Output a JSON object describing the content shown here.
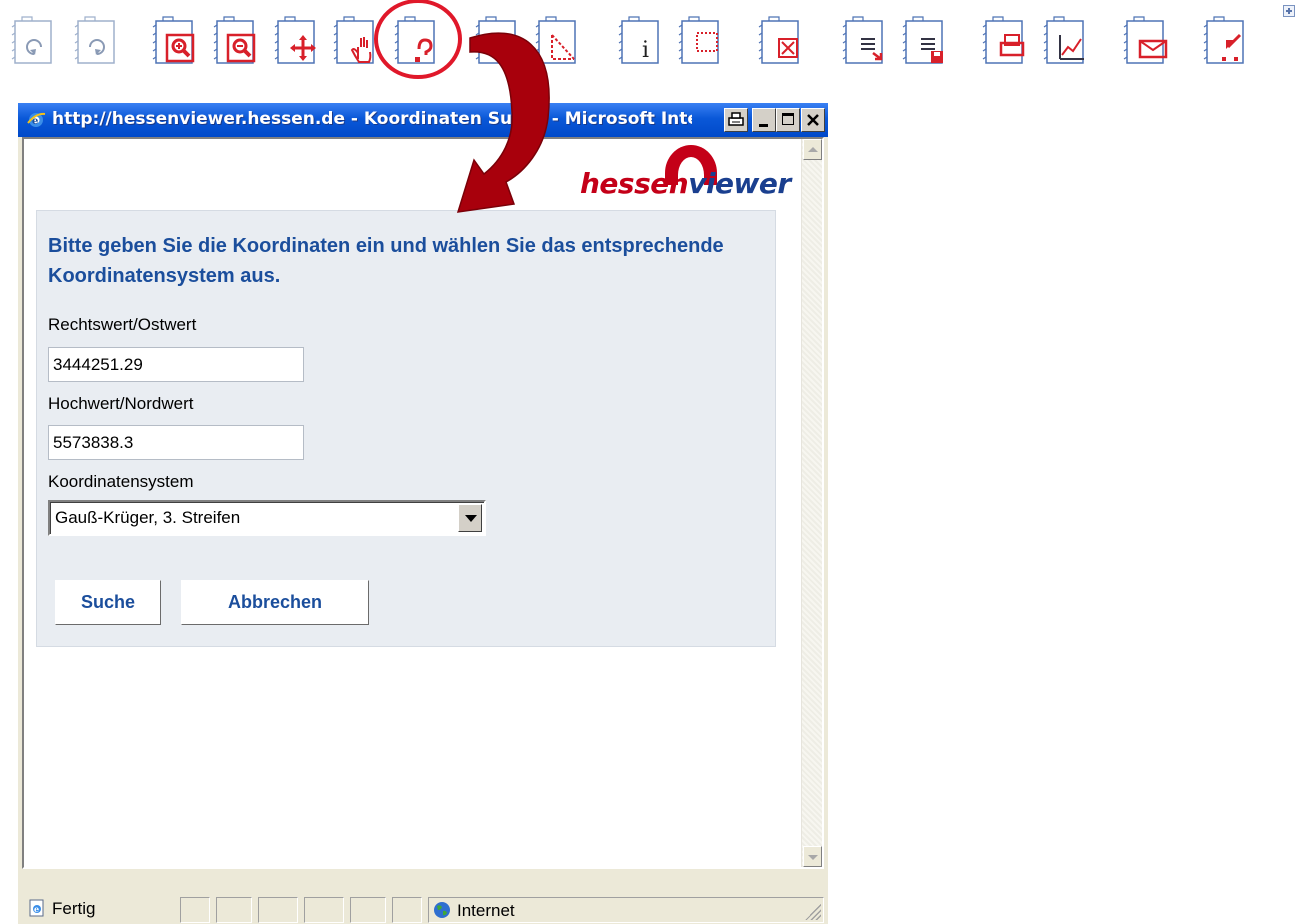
{
  "toolbar": {
    "buttons": [
      {
        "name": "back-button",
        "icon": "back-arrow-icon",
        "active": false
      },
      {
        "name": "forward-button",
        "icon": "forward-arrow-icon",
        "active": false
      },
      {
        "name": "zoom-in-button",
        "icon": "zoom-in-icon",
        "active": true
      },
      {
        "name": "zoom-out-button",
        "icon": "zoom-out-icon",
        "active": true
      },
      {
        "name": "pan-button",
        "icon": "pan-arrows-icon",
        "active": true
      },
      {
        "name": "hand-button",
        "icon": "hand-icon",
        "active": true
      },
      {
        "name": "coordinate-search-button",
        "icon": "coordinate-search-icon",
        "active": true
      },
      {
        "name": "full-extent-button",
        "icon": "full-extent-icon",
        "active": true
      },
      {
        "name": "measure-button",
        "icon": "measure-icon",
        "active": true
      },
      {
        "name": "info-button",
        "icon": "info-icon",
        "active": true
      },
      {
        "name": "select-area-button",
        "icon": "select-area-icon",
        "active": true
      },
      {
        "name": "clear-selection-button",
        "icon": "clear-selection-icon",
        "active": true
      },
      {
        "name": "legend-button",
        "icon": "legend-icon",
        "active": true
      },
      {
        "name": "save-button",
        "icon": "save-icon",
        "active": true
      },
      {
        "name": "print-button",
        "icon": "print-icon",
        "active": true
      },
      {
        "name": "profile-button",
        "icon": "profile-chart-icon",
        "active": true
      },
      {
        "name": "mail-button",
        "icon": "mail-icon",
        "active": true
      },
      {
        "name": "export-button",
        "icon": "export-icon",
        "active": true
      }
    ],
    "expand_icon": "plus-icon"
  },
  "window": {
    "title": "http://hessenviewer.hessen.de - Koordinaten Suche - Microsoft Internet Explorer",
    "logo": {
      "part1": "hessen",
      "part2": "viewer"
    },
    "intro": "Bitte geben Sie die Koordinaten ein und wählen Sie das entsprechende Koordinatensystem aus.",
    "east_label": "Rechtswert/Ostwert",
    "east_value": "3444251.29",
    "north_label": "Hochwert/Nordwert",
    "north_value": "5573838.3",
    "crs_label": "Koordinatensystem",
    "crs_selected": "Gauß-Krüger, 3. Streifen",
    "search_button": "Suche",
    "cancel_button": "Abbrechen"
  },
  "statusbar": {
    "status": "Fertig",
    "zone": "Internet"
  },
  "colors": {
    "accent_red": "#c40018",
    "brand_blue": "#1b4e9c",
    "xp_title_blue": "#0a58d8"
  }
}
